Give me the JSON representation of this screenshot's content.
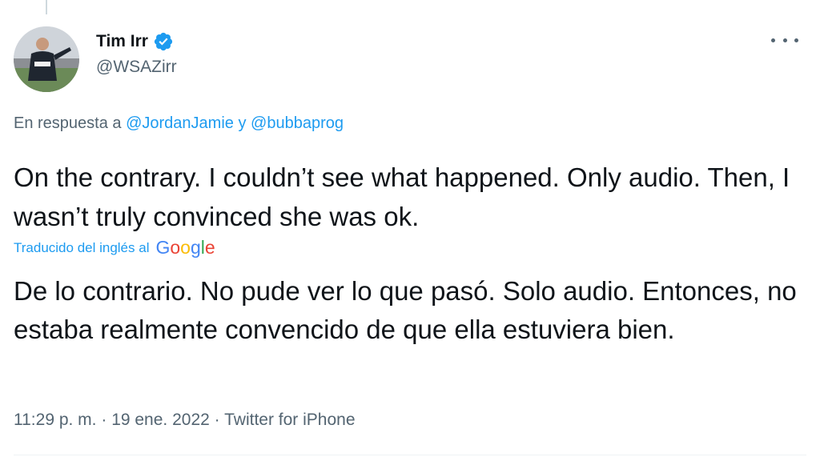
{
  "author": {
    "display_name": "Tim Irr",
    "handle": "@WSAZirr",
    "verified": true,
    "avatar_icon": "profile-photo",
    "verified_color": "#1d9bf0"
  },
  "reply_context": {
    "prefix": "En respuesta a ",
    "mention_1": "@JordanJamie",
    "connector": " y ",
    "mention_2": "@bubbaprog"
  },
  "tweet": {
    "text": "On the contrary. I couldn’t see what happened. Only audio. Then, I wasn’t truly convinced she was ok."
  },
  "translation": {
    "label": "Traducido del inglés al",
    "provider": "Google",
    "text": "De lo contrario. No pude ver lo que pasó. Solo audio. Entonces, no estaba realmente convencido de que ella estuviera bien."
  },
  "meta": {
    "time": "11:29 p. m.",
    "separator": " · ",
    "date": "19 ene. 2022",
    "source": "Twitter for iPhone"
  },
  "colors": {
    "link": "#1d9bf0",
    "secondary_text": "#536471",
    "primary_text": "#0f1419"
  }
}
